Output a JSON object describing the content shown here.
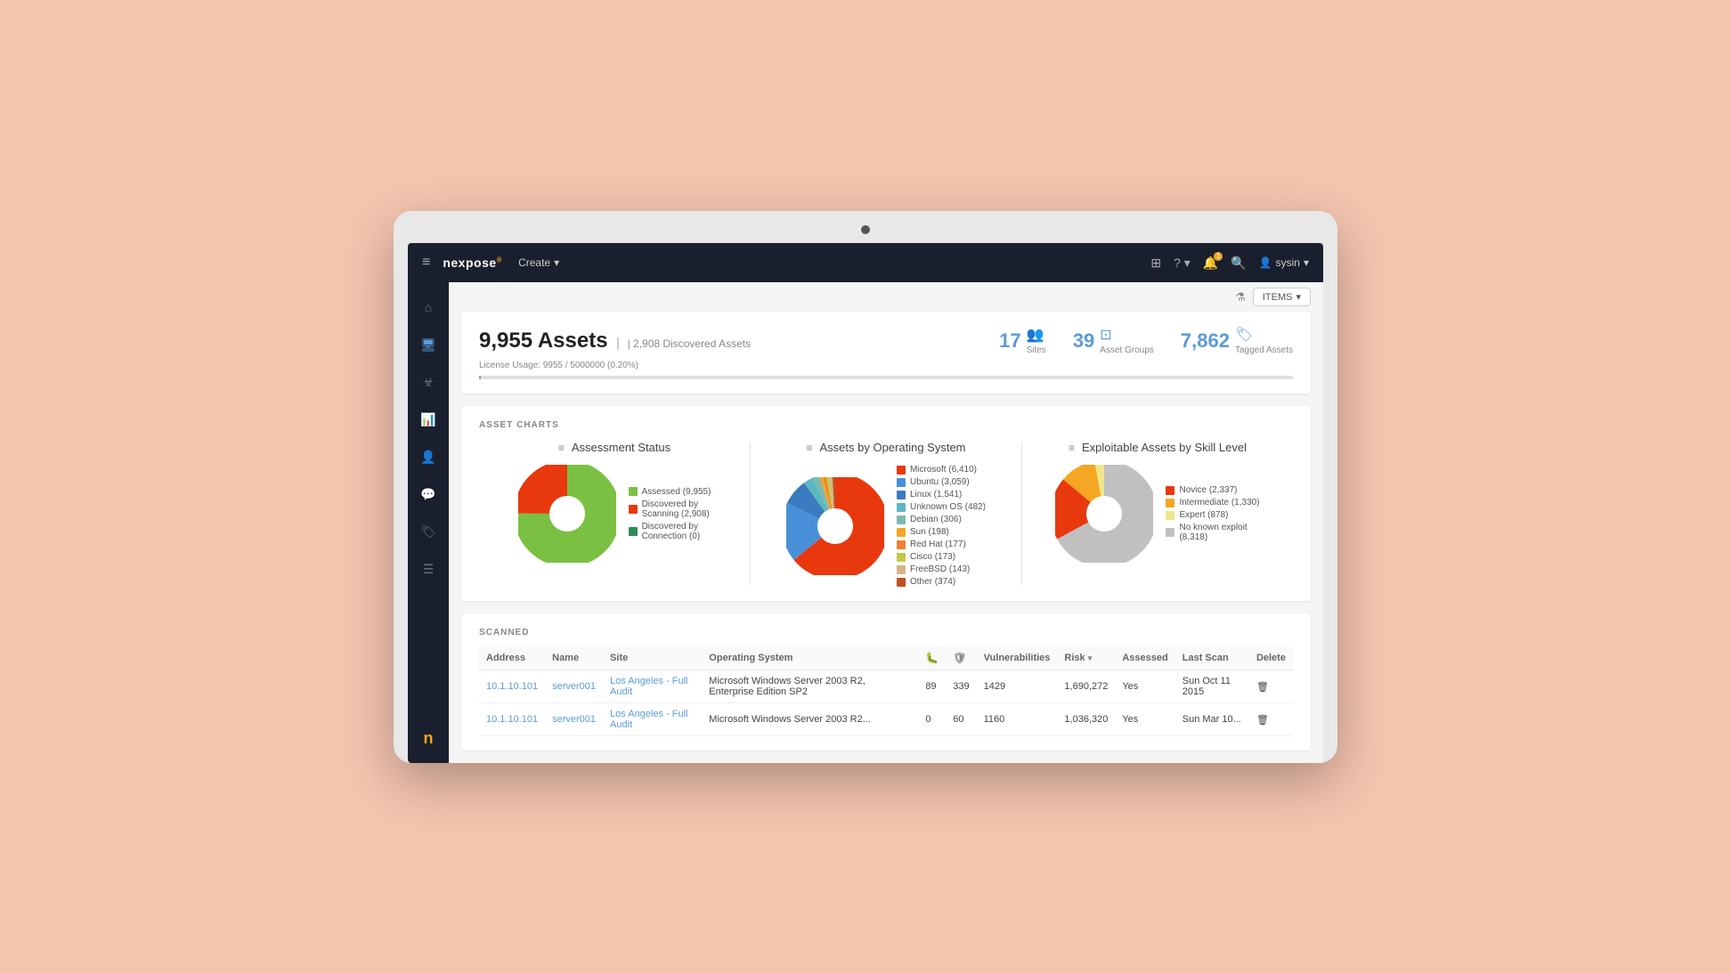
{
  "monitor": {
    "dot_visible": true
  },
  "topnav": {
    "hamburger": "≡",
    "logo": "nexpose",
    "logo_sup": "®",
    "create_label": "Create",
    "create_arrow": "▾",
    "icons": {
      "grid": "⊞",
      "help": "?",
      "bell": "🔔",
      "bell_badge": "1",
      "search": "🔍",
      "user_icon": "👤",
      "username": "sysin",
      "user_arrow": "▾"
    }
  },
  "sidebar": {
    "items": [
      {
        "name": "home",
        "icon": "⌂",
        "active": false
      },
      {
        "name": "assets",
        "icon": "🖥",
        "active": true
      },
      {
        "name": "vulnerabilities",
        "icon": "☣",
        "active": false
      },
      {
        "name": "reports",
        "icon": "📊",
        "active": false
      },
      {
        "name": "users",
        "icon": "👤",
        "active": false
      },
      {
        "name": "messages",
        "icon": "💬",
        "active": false
      },
      {
        "name": "tags",
        "icon": "🏷",
        "active": false
      },
      {
        "name": "list",
        "icon": "☰",
        "active": false
      }
    ],
    "bottom_logo": "n"
  },
  "topbar": {
    "filter_icon": "⚗",
    "items_btn": "ITEMS",
    "items_arrow": "▾"
  },
  "assets": {
    "count": "9,955 Assets",
    "discovered": "2,908 Discovered Assets",
    "license_label": "License Usage: 9955 / 5000000 (0.20%)",
    "progress_percent": 0.2,
    "stats": [
      {
        "number": "17",
        "icon": "👥",
        "label": "Sites"
      },
      {
        "number": "39",
        "icon": "⊡",
        "label": "Asset Groups"
      },
      {
        "number": "7,862",
        "icon": "🏷",
        "label": "Tagged Assets"
      }
    ]
  },
  "charts_section": {
    "label": "ASSET CHARTS",
    "charts": [
      {
        "title": "Assessment Status",
        "legend": [
          {
            "label": "Assessed (9,955)",
            "color": "#7bc043"
          },
          {
            "label": "Discovered by Scanning (2,908)",
            "color": "#e8380d"
          },
          {
            "label": "Discovered by Connection (0)",
            "color": "#2e8b57"
          }
        ],
        "pie_slices": [
          {
            "label": "Assessed",
            "color": "#7bc043",
            "percent": 75
          },
          {
            "label": "Discovered Scanning",
            "color": "#e8380d",
            "percent": 25
          },
          {
            "label": "Discovered Connection",
            "color": "#2e8b57",
            "percent": 0
          }
        ]
      },
      {
        "title": "Assets by Operating System",
        "legend": [
          {
            "label": "Microsoft (6,410)",
            "color": "#e8380d"
          },
          {
            "label": "Ubuntu (3,059)",
            "color": "#4a90d9"
          },
          {
            "label": "Linux (1,541)",
            "color": "#3b7bbf"
          },
          {
            "label": "Unknown OS (482)",
            "color": "#5bb8c1"
          },
          {
            "label": "Debian (306)",
            "color": "#7cb9b0"
          },
          {
            "label": "Sun (198)",
            "color": "#f5a623"
          },
          {
            "label": "Red Hat (177)",
            "color": "#f08030"
          },
          {
            "label": "Cisco (173)",
            "color": "#c8c84a"
          },
          {
            "label": "FreeBSD (143)",
            "color": "#d4b483"
          },
          {
            "label": "Other (374)",
            "color": "#c05020"
          }
        ],
        "pie_slices": [
          {
            "label": "Microsoft",
            "color": "#e8380d",
            "percent": 64
          },
          {
            "label": "Ubuntu",
            "color": "#4a90d9",
            "percent": 18
          },
          {
            "label": "Linux",
            "color": "#3b7bbf",
            "percent": 8
          },
          {
            "label": "Unknown OS",
            "color": "#5bb8c1",
            "percent": 3
          },
          {
            "label": "Debian",
            "color": "#7cb9b0",
            "percent": 2
          },
          {
            "label": "Sun",
            "color": "#f5a623",
            "percent": 1
          },
          {
            "label": "Red Hat",
            "color": "#f08030",
            "percent": 1
          },
          {
            "label": "Cisco",
            "color": "#c8c84a",
            "percent": 1
          },
          {
            "label": "FreeBSD",
            "color": "#d4b483",
            "percent": 1
          },
          {
            "label": "Other",
            "color": "#c05020",
            "percent": 2
          }
        ]
      },
      {
        "title": "Exploitable Assets by Skill Level",
        "legend": [
          {
            "label": "Novice (2,337)",
            "color": "#e8380d"
          },
          {
            "label": "Intermediate (1,330)",
            "color": "#f5a623"
          },
          {
            "label": "Expert (878)",
            "color": "#f0e68c"
          },
          {
            "label": "No known exploit (8,318)",
            "color": "#c0c0c0"
          }
        ],
        "pie_slices": [
          {
            "label": "No known exploit",
            "color": "#c0c0c0",
            "percent": 67
          },
          {
            "label": "Novice",
            "color": "#e8380d",
            "percent": 19
          },
          {
            "label": "Intermediate",
            "color": "#f5a623",
            "percent": 11
          },
          {
            "label": "Expert",
            "color": "#f0e68c",
            "percent": 3
          }
        ]
      }
    ]
  },
  "table": {
    "section_label": "SCANNED",
    "columns": [
      {
        "key": "address",
        "label": "Address"
      },
      {
        "key": "name",
        "label": "Name"
      },
      {
        "key": "site",
        "label": "Site"
      },
      {
        "key": "os",
        "label": "Operating System"
      },
      {
        "key": "vuln_icon1",
        "label": "🐛"
      },
      {
        "key": "vuln_icon2",
        "label": "🛡"
      },
      {
        "key": "vulnerabilities",
        "label": "Vulnerabilities"
      },
      {
        "key": "risk",
        "label": "Risk ▾"
      },
      {
        "key": "assessed",
        "label": "Assessed"
      },
      {
        "key": "last_scan",
        "label": "Last Scan"
      },
      {
        "key": "delete",
        "label": "Delete"
      }
    ],
    "rows": [
      {
        "address": "10.1.10.101",
        "name": "server001",
        "site": "Los Angeles - Full Audit",
        "os": "Microsoft Windows Server 2003 R2, Enterprise Edition SP2",
        "v1": "89",
        "v2": "339",
        "vulnerabilities": "1429",
        "risk": "1,690,272",
        "assessed": "Yes",
        "last_scan": "Sun Oct 11 2015",
        "delete": "🗑"
      },
      {
        "address": "10.1.10.101",
        "name": "server001",
        "site": "Los Angeles - Full Audit",
        "os": "Microsoft Windows Server 2003 R2...",
        "v1": "0",
        "v2": "60",
        "vulnerabilities": "1160",
        "risk": "1,036,320",
        "assessed": "Yes",
        "last_scan": "Sun Mar 10...",
        "delete": "🗑"
      }
    ]
  }
}
